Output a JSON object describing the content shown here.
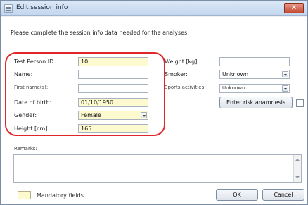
{
  "window": {
    "title": "Edit session info",
    "close_glyph": "✕"
  },
  "intro_text": "Please complete the session info data needed for the analyses.",
  "left_fields": {
    "test_person_id": {
      "label": "Test Person ID:",
      "value": "10"
    },
    "name": {
      "label": "Name:",
      "value": ""
    },
    "first_names": {
      "label": "First name(s):",
      "value": ""
    },
    "date_of_birth": {
      "label": "Date of birth:",
      "value": "01/10/1950"
    },
    "gender": {
      "label": "Gender:",
      "value": "Female"
    },
    "height": {
      "label": "Height [cm]:",
      "value": "165"
    }
  },
  "right_fields": {
    "weight": {
      "label": "Weight [kg]:",
      "value": ""
    },
    "smoker": {
      "label": "Smoker:",
      "value": "Unknown"
    },
    "sports": {
      "label": "Sports activities:",
      "value": "Unknown"
    }
  },
  "buttons": {
    "risk_anamnesis": "Enter risk anamnesis",
    "ok": "OK",
    "cancel": "Cancel"
  },
  "remarks": {
    "label": "Remarks:",
    "value": ""
  },
  "legend": {
    "text": "Mandatory fields"
  },
  "colors": {
    "mandatory_bg": "#fdfad0",
    "highlight": "#e0262a",
    "close_button": "#c44a32"
  }
}
